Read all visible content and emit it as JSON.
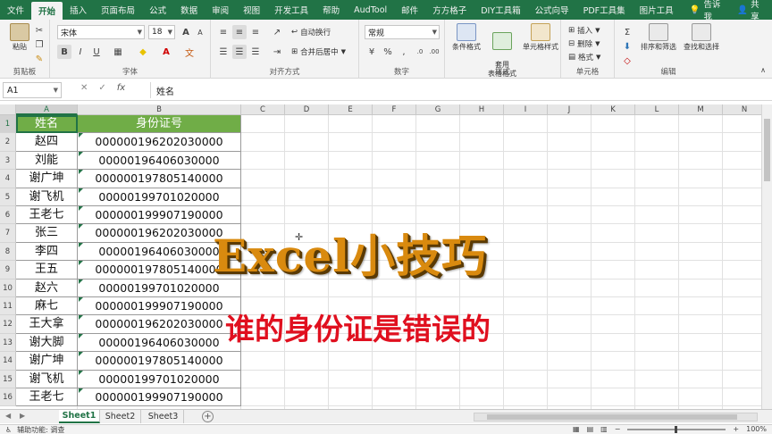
{
  "ribbon_tabs": [
    "文件",
    "开始",
    "插入",
    "页面布局",
    "公式",
    "数据",
    "审阅",
    "视图",
    "开发工具",
    "帮助",
    "AudTool",
    "邮件",
    "方方格子",
    "DIY工具箱",
    "公式向导",
    "PDF工具集",
    "图片工具"
  ],
  "active_tab_index": 1,
  "tell_me": "告诉我",
  "share": "共享",
  "ribbon": {
    "paste_label": "粘贴",
    "clipboard_label": "剪贴板",
    "font_name": "宋体",
    "font_size": "18",
    "font_label": "字体",
    "wrap_text": "自动换行",
    "merge_center": "合并后居中",
    "alignment_label": "对齐方式",
    "number_format": "常规",
    "number_label": "数字",
    "cond_format": "条件格式",
    "table_format": "套用\n表格格式",
    "cell_style": "单元格样式",
    "styles_label": "样式",
    "insert": "插入",
    "delete": "删除",
    "format": "格式",
    "cells_label": "单元格",
    "sort_filter": "排序和筛选",
    "find_select": "查找和选择",
    "editing_label": "编辑"
  },
  "formula_bar": {
    "name_box": "A1",
    "content": "姓名"
  },
  "columns": [
    "A",
    "B",
    "C",
    "D",
    "E",
    "F",
    "G",
    "H",
    "I",
    "J",
    "K",
    "L",
    "M",
    "N"
  ],
  "rows": [
    "1",
    "2",
    "3",
    "4",
    "5",
    "6",
    "7",
    "8",
    "9",
    "10",
    "11",
    "12",
    "13",
    "14",
    "15",
    "16"
  ],
  "table": {
    "headers": [
      "姓名",
      "身份证号"
    ],
    "rows": [
      [
        "赵四",
        "000000196202030000"
      ],
      [
        "刘能",
        "00000196406030000"
      ],
      [
        "谢广坤",
        "000000197805140000"
      ],
      [
        "谢飞机",
        "00000199701020000"
      ],
      [
        "王老七",
        "000000199907190000"
      ],
      [
        "张三",
        "000000196202030000"
      ],
      [
        "李四",
        "00000196406030000"
      ],
      [
        "王五",
        "000000197805140000"
      ],
      [
        "赵六",
        "00000199701020000"
      ],
      [
        "麻七",
        "000000199907190000"
      ],
      [
        "王大拿",
        "000000196202030000"
      ],
      [
        "谢大脚",
        "00000196406030000"
      ],
      [
        "谢广坤",
        "000000197805140000"
      ],
      [
        "谢飞机",
        "00000199701020000"
      ],
      [
        "王老七",
        "000000199907190000"
      ]
    ]
  },
  "overlay": {
    "title": "Excel小技巧",
    "subtitle": "谁的身份证是错误的"
  },
  "sheets": [
    "Sheet1",
    "Sheet2",
    "Sheet3"
  ],
  "active_sheet_index": 0,
  "status": {
    "accessibility": "辅助功能: 调查",
    "zoom": "100%"
  },
  "colors": {
    "excel_green": "#217346",
    "header_fill": "#70ad47",
    "title_orange": "#d98a0f",
    "subtitle_red": "#e0101f"
  }
}
